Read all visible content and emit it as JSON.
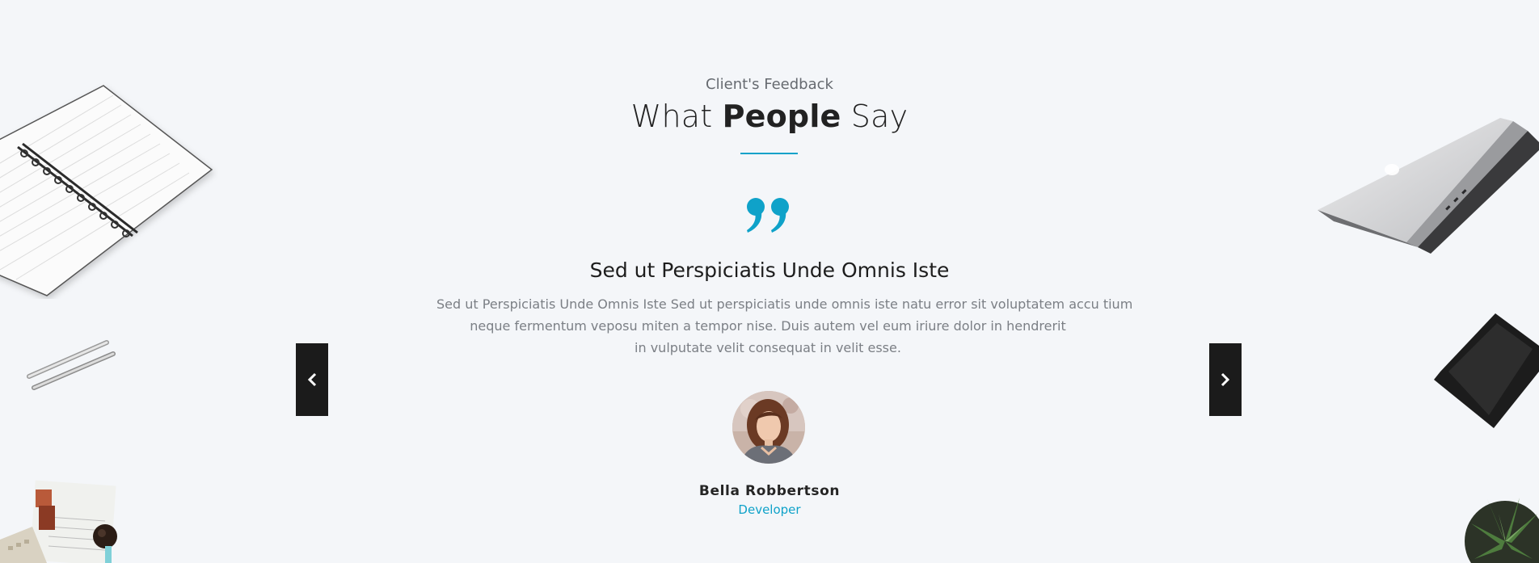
{
  "section": {
    "subtitle": "Client's Feedback",
    "title_before": "What ",
    "title_bold": "People",
    "title_after": " Say",
    "accent_color": "#0fa2c9"
  },
  "testimonial": {
    "heading": "Sed ut Perspiciatis Unde Omnis Iste",
    "body_lines": [
      "Sed ut Perspiciatis Unde Omnis Iste Sed ut perspiciatis unde omnis iste natu error sit voluptatem accu tium",
      "neque fermentum veposu miten a tempor nise. Duis autem vel eum iriure dolor in hendrerit",
      "in vulputate velit consequat in velit esse."
    ],
    "author_name": "Bella Robbertson",
    "author_role": "Developer"
  },
  "navigation": {
    "prev_icon": "chevron-left-icon",
    "next_icon": "chevron-right-icon"
  },
  "decor": {
    "left": [
      "notebook",
      "pens",
      "desk-items"
    ],
    "right": [
      "laptop",
      "tablet",
      "plant"
    ]
  }
}
